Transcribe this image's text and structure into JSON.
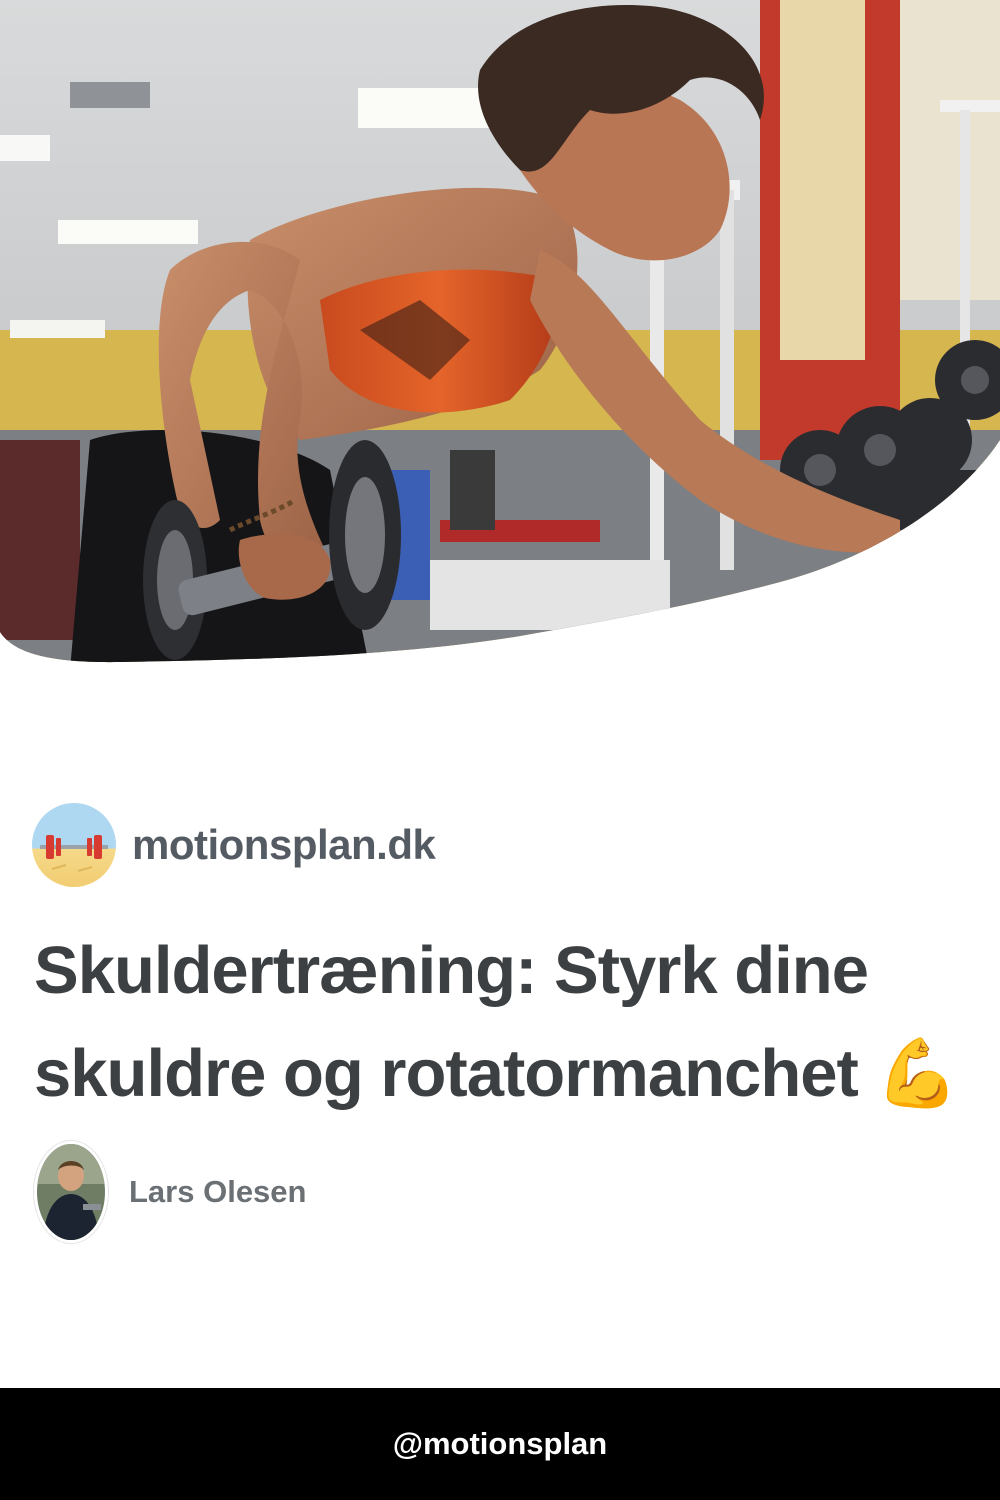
{
  "hero": {
    "image": "woman-dumbbell-row-gym-photo"
  },
  "site": {
    "logo_icon": "barbell-logo-icon",
    "name": "motionsplan.dk"
  },
  "article": {
    "title": "Skuldertræning: Styrk dine skuldre og rotatormanchet",
    "title_emoji": "💪"
  },
  "author": {
    "avatar_icon": "author-photo",
    "name": "Lars Olesen"
  },
  "footer": {
    "handle": "@motionsplan"
  },
  "colors": {
    "text_dark": "#3c4043",
    "text_muted": "#6b7075",
    "footer_bg": "#000000",
    "footer_text": "#ffffff"
  }
}
